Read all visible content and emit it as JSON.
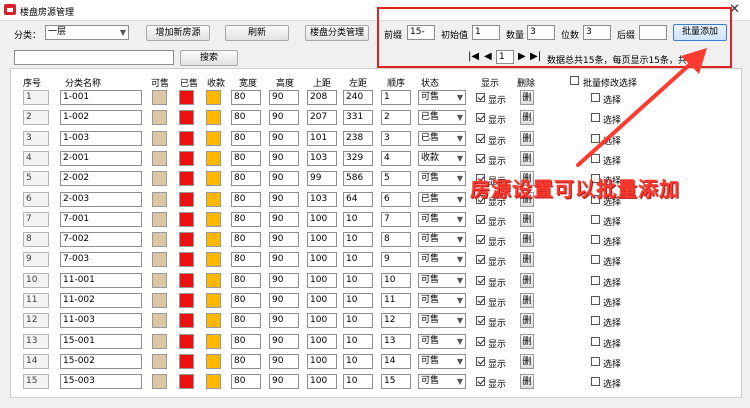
{
  "window": {
    "title": "楼盘房源管理",
    "close": "✕"
  },
  "toolbar": {
    "category_label": "分类：",
    "category_value": "一层",
    "add_button": "增加新房源",
    "refresh_button": "刷新",
    "category_manage_button": "楼盘分类管理",
    "search_button": "搜索",
    "search_value": ""
  },
  "batch": {
    "prefix_label": "前缀",
    "prefix_value": "15-",
    "start_label": "初始值",
    "start_value": "1",
    "count_label": "数量",
    "count_value": "3",
    "digits_label": "位数",
    "digits_value": "3",
    "suffix_label": "后缀",
    "suffix_value": "",
    "add_button": "批量添加"
  },
  "pager": {
    "first": "|◀",
    "prev": "◀",
    "page": "1",
    "next": "▶",
    "last": "▶|",
    "info": "数据总共15条，每页显示15条，共1"
  },
  "columns": {
    "seq": "序号",
    "name": "分类名称",
    "sellable": "可售",
    "sold": "已售",
    "reserved": "收款",
    "width": "宽度",
    "height": "高度",
    "top": "上距",
    "left": "左距",
    "order": "顺序",
    "status": "状态",
    "show": "显示",
    "delete": "删除",
    "batch_edit": "批量修改选择"
  },
  "row_labels": {
    "show": "显示",
    "delete": "删",
    "select": "选择"
  },
  "annotation": "房源设置可以批量添加",
  "colors": {
    "sellable": "#dbc7a6",
    "sold": "#ee1111",
    "reserved": "#ffb700",
    "highlight": "#e02424"
  },
  "rows": [
    {
      "seq": "1",
      "name": "1-001",
      "width": "80",
      "height": "90",
      "top": "208",
      "left": "240",
      "order": "1",
      "status": "可售"
    },
    {
      "seq": "2",
      "name": "1-002",
      "width": "80",
      "height": "90",
      "top": "207",
      "left": "331",
      "order": "2",
      "status": "已售"
    },
    {
      "seq": "3",
      "name": "1-003",
      "width": "80",
      "height": "90",
      "top": "101",
      "left": "238",
      "order": "3",
      "status": "已售"
    },
    {
      "seq": "4",
      "name": "2-001",
      "width": "80",
      "height": "90",
      "top": "103",
      "left": "329",
      "order": "4",
      "status": "收款"
    },
    {
      "seq": "5",
      "name": "2-002",
      "width": "80",
      "height": "90",
      "top": "99",
      "left": "586",
      "order": "5",
      "status": "可售"
    },
    {
      "seq": "6",
      "name": "2-003",
      "width": "80",
      "height": "90",
      "top": "103",
      "left": "64",
      "order": "6",
      "status": "已售"
    },
    {
      "seq": "7",
      "name": "7-001",
      "width": "80",
      "height": "90",
      "top": "100",
      "left": "10",
      "order": "7",
      "status": "可售"
    },
    {
      "seq": "8",
      "name": "7-002",
      "width": "80",
      "height": "90",
      "top": "100",
      "left": "10",
      "order": "8",
      "status": "可售"
    },
    {
      "seq": "9",
      "name": "7-003",
      "width": "80",
      "height": "90",
      "top": "100",
      "left": "10",
      "order": "9",
      "status": "可售"
    },
    {
      "seq": "10",
      "name": "11-001",
      "width": "80",
      "height": "90",
      "top": "100",
      "left": "10",
      "order": "10",
      "status": "可售"
    },
    {
      "seq": "11",
      "name": "11-002",
      "width": "80",
      "height": "90",
      "top": "100",
      "left": "10",
      "order": "11",
      "status": "可售"
    },
    {
      "seq": "12",
      "name": "11-003",
      "width": "80",
      "height": "90",
      "top": "100",
      "left": "10",
      "order": "12",
      "status": "可售"
    },
    {
      "seq": "13",
      "name": "15-001",
      "width": "80",
      "height": "90",
      "top": "100",
      "left": "10",
      "order": "13",
      "status": "可售"
    },
    {
      "seq": "14",
      "name": "15-002",
      "width": "80",
      "height": "90",
      "top": "100",
      "left": "10",
      "order": "14",
      "status": "可售"
    },
    {
      "seq": "15",
      "name": "15-003",
      "width": "80",
      "height": "90",
      "top": "100",
      "left": "10",
      "order": "15",
      "status": "可售"
    }
  ]
}
